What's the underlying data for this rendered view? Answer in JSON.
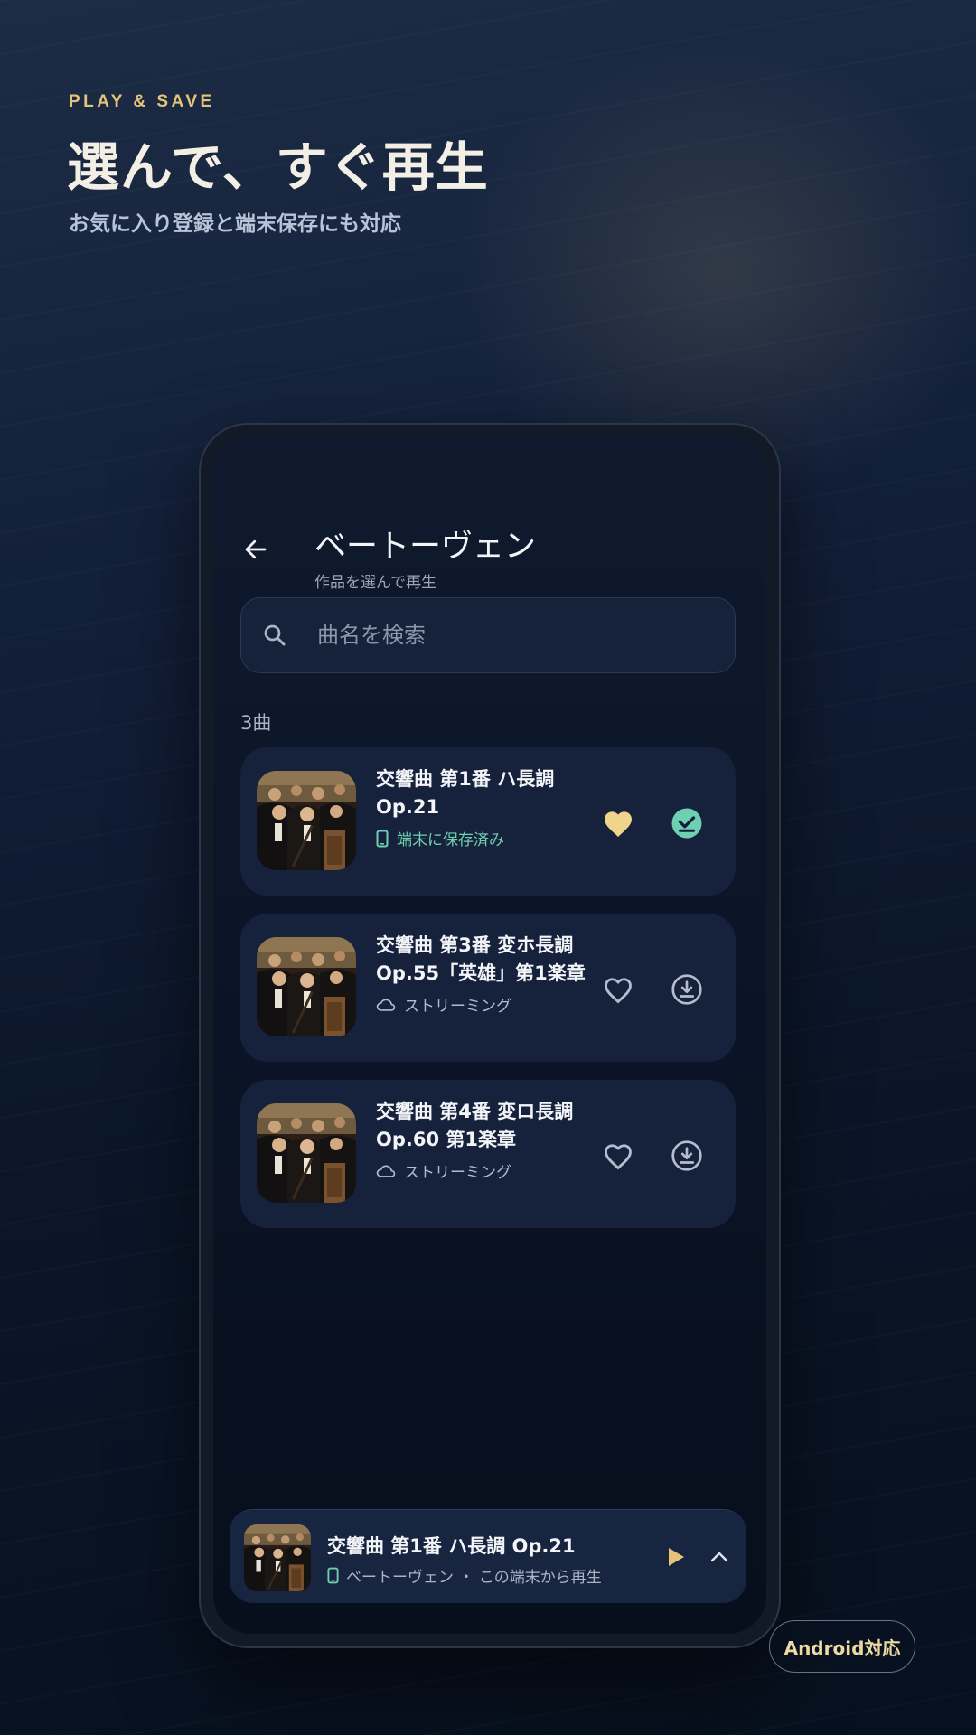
{
  "promo": {
    "eyebrow": "PLAY & SAVE",
    "headline": "選んで、すぐ再生",
    "subhead": "お気に入り登録と端末保存にも対応",
    "badge": "Android対応"
  },
  "app": {
    "title": "ベートーヴェン",
    "subtitle": "作品を選んで再生",
    "search_placeholder": "曲名を検索",
    "count_label": "3曲"
  },
  "tracks": [
    {
      "title_line1": "交響曲 第1番 ハ長調",
      "title_line2": "Op.21",
      "status": "端末に保存済み",
      "status_icon": "phone-icon",
      "favorite": true,
      "downloaded": true
    },
    {
      "title_line1": "交響曲 第3番 変ホ長調",
      "title_line2": "Op.55「英雄」第1楽章",
      "status": "ストリーミング",
      "status_icon": "cloud-icon",
      "favorite": false,
      "downloaded": false
    },
    {
      "title_line1": "交響曲 第4番 変ロ長調",
      "title_line2": "Op.60 第1楽章",
      "status": "ストリーミング",
      "status_icon": "cloud-icon",
      "favorite": false,
      "downloaded": false
    }
  ],
  "player": {
    "title": "交響曲 第1番 ハ長調 Op.21",
    "subtitle": "ベートーヴェン ・ この端末から再生"
  },
  "colors": {
    "accent_gold": "#e6c37a",
    "saved_green": "#6fcfb1",
    "card_bg": "#16223b"
  }
}
